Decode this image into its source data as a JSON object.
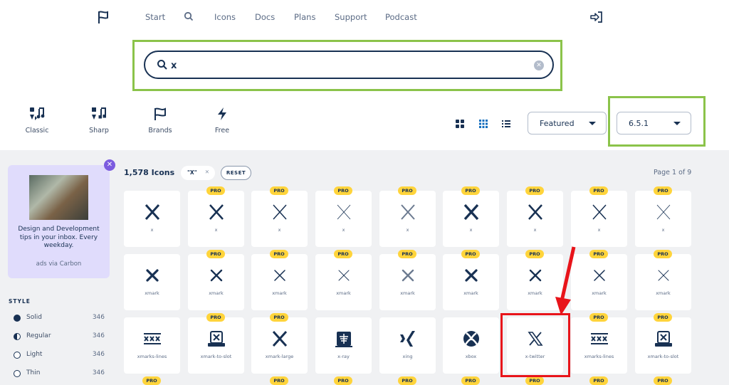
{
  "nav": {
    "items": [
      "Start",
      "Icons",
      "Docs",
      "Plans",
      "Support",
      "Podcast"
    ]
  },
  "search": {
    "value": "x"
  },
  "families": [
    "Classic",
    "Sharp",
    "Brands",
    "Free"
  ],
  "sort": {
    "label": "Featured"
  },
  "version": {
    "label": "6.5.1"
  },
  "ad": {
    "text": "Design and Development tips in your inbox. Every weekday.",
    "via": "ads via Carbon"
  },
  "style_panel": {
    "title": "STYLE",
    "items": [
      {
        "name": "Solid",
        "count": "346"
      },
      {
        "name": "Regular",
        "count": "346"
      },
      {
        "name": "Light",
        "count": "346"
      },
      {
        "name": "Thin",
        "count": "346"
      }
    ]
  },
  "results": {
    "count": "1,578 Icons",
    "chip": "\"X\"",
    "reset": "RESET",
    "page": "Page 1 of 9",
    "pro_label": "PRO"
  },
  "icons": [
    {
      "name": "x",
      "pro": false
    },
    {
      "name": "x",
      "pro": true
    },
    {
      "name": "x",
      "pro": true
    },
    {
      "name": "x",
      "pro": true
    },
    {
      "name": "x",
      "pro": true
    },
    {
      "name": "x",
      "pro": true
    },
    {
      "name": "x",
      "pro": true
    },
    {
      "name": "x",
      "pro": true
    },
    {
      "name": "x",
      "pro": true
    },
    {
      "name": "xmark",
      "pro": false
    },
    {
      "name": "xmark",
      "pro": true
    },
    {
      "name": "xmark",
      "pro": true
    },
    {
      "name": "xmark",
      "pro": true
    },
    {
      "name": "xmark",
      "pro": true
    },
    {
      "name": "xmark",
      "pro": true
    },
    {
      "name": "xmark",
      "pro": true
    },
    {
      "name": "xmark",
      "pro": true
    },
    {
      "name": "xmark",
      "pro": true
    },
    {
      "name": "xmarks-lines",
      "pro": false
    },
    {
      "name": "xmark-to-slot",
      "pro": true
    },
    {
      "name": "xmark-large",
      "pro": true
    },
    {
      "name": "x-ray",
      "pro": false
    },
    {
      "name": "xing",
      "pro": false
    },
    {
      "name": "xbox",
      "pro": false
    },
    {
      "name": "x-twitter",
      "pro": false
    },
    {
      "name": "xmarks-lines",
      "pro": true
    },
    {
      "name": "xmark-to-slot",
      "pro": true
    }
  ],
  "colors": {
    "accent": "#183153",
    "highlight": "#e8141a",
    "outline": "#8bc34a",
    "pro": "#ffd43b"
  }
}
